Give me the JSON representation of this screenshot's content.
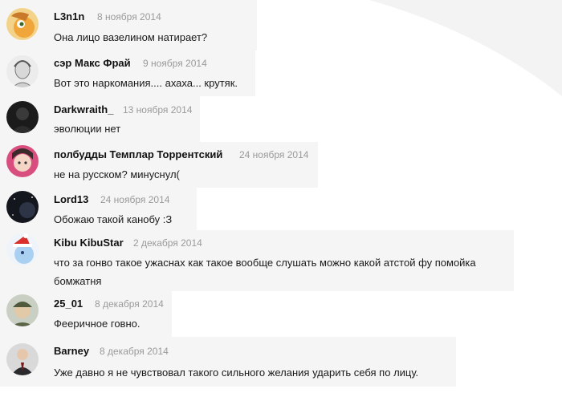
{
  "comments": [
    {
      "author": "L3n1n",
      "date": "8 ноября 2014",
      "text": "Она лицо вазелином натирает?",
      "avatar": "pony-avatar"
    },
    {
      "author": "сэр Макс Фрай",
      "date": "9 ноября 2014",
      "text": "Вот это наркомания.... ахаха... крутяк.",
      "avatar": "sketch-portrait-avatar"
    },
    {
      "author": "Darkwraith_",
      "date": "13 ноября 2014",
      "text": "эволюции нет",
      "avatar": "dark-figure-avatar"
    },
    {
      "author": "полбудды Темплар Торрентский",
      "date": "24 ноября 2014",
      "text": "не на русском? минуснул(",
      "avatar": "anime-girl-avatar"
    },
    {
      "author": "Lord13",
      "date": "24 ноября 2014",
      "text": "Обожаю такой канобу :З",
      "avatar": "space-avatar"
    },
    {
      "author": "Kibu KibuStar",
      "date": "2 декабря 2014",
      "text": "что за гонво такое ужаснах как такое вообще слушать можно какой атстой фу помойка",
      "text2": "бомжатня",
      "avatar": "santa-pony-avatar"
    },
    {
      "author": "25_01",
      "date": "8 декабря 2014",
      "text": "Фееричное говно.",
      "avatar": "soldier-avatar"
    },
    {
      "author": "Barney",
      "date": "8 декабря 2014",
      "text": "Уже давно я не чувствовал такого сильного желания ударить себя по лицу.",
      "avatar": "suit-man-avatar"
    }
  ]
}
